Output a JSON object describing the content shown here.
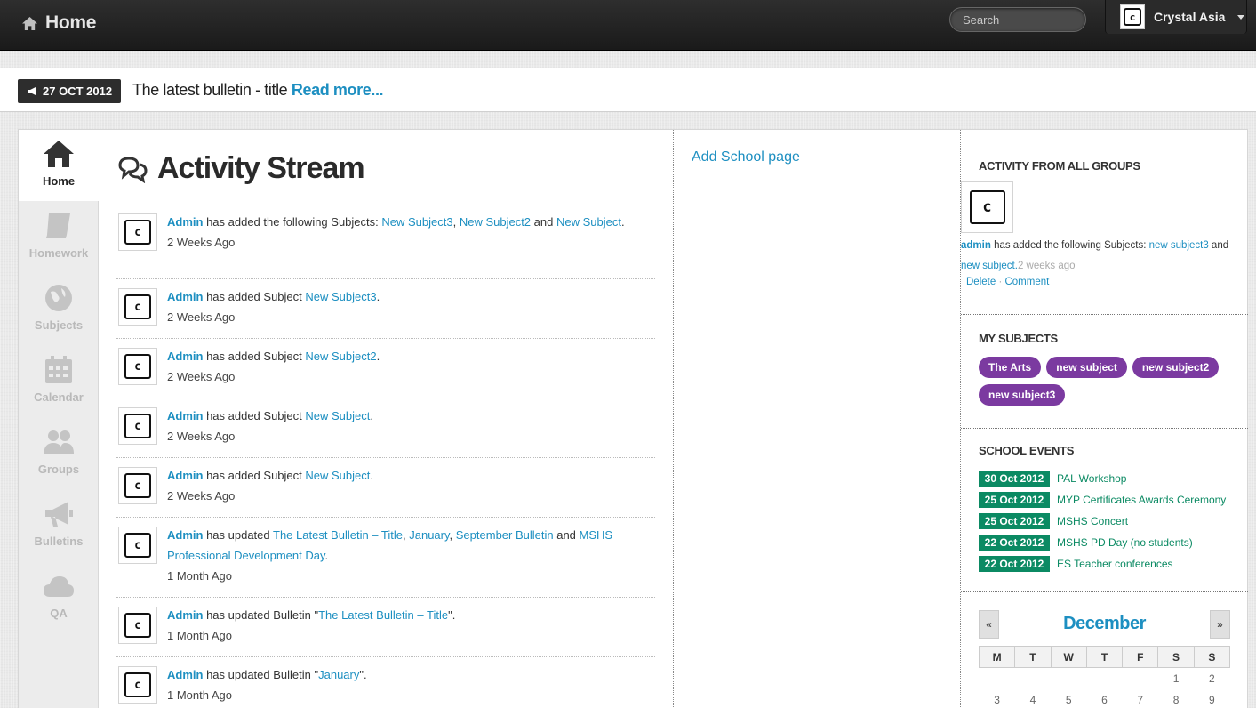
{
  "topbar": {
    "home_label": "Home",
    "search_placeholder": "Search",
    "user_name": "Crystal Asia"
  },
  "bulletin": {
    "date": "27 OCT 2012",
    "title": "The latest bulletin - title",
    "read_more": "Read more..."
  },
  "sidenav": {
    "items": [
      {
        "label": "Home",
        "icon": "home-icon"
      },
      {
        "label": "Homework",
        "icon": "book-icon"
      },
      {
        "label": "Subjects",
        "icon": "globe-icon"
      },
      {
        "label": "Calendar",
        "icon": "calendar-icon"
      },
      {
        "label": "Groups",
        "icon": "group-icon"
      },
      {
        "label": "Bulletins",
        "icon": "megaphone-icon"
      },
      {
        "label": "QA",
        "icon": "cloud-icon"
      }
    ]
  },
  "stream": {
    "title": "Activity Stream",
    "items": [
      {
        "actor": "Admin",
        "action": " has added the following Subjects: ",
        "links": [
          "New Subject3",
          "New Subject2",
          "New Subject"
        ],
        "time": "2 Weeks Ago"
      },
      {
        "actor": "Admin",
        "action": " has added Subject ",
        "links": [
          "New Subject3"
        ],
        "time": "2 Weeks Ago"
      },
      {
        "actor": "Admin",
        "action": " has added Subject ",
        "links": [
          "New Subject2"
        ],
        "time": "2 Weeks Ago"
      },
      {
        "actor": "Admin",
        "action": " has added Subject ",
        "links": [
          "New Subject"
        ],
        "time": "2 Weeks Ago"
      },
      {
        "actor": "Admin",
        "action": " has added Subject ",
        "links": [
          "New Subject"
        ],
        "time": "2 Weeks Ago"
      },
      {
        "actor": "Admin",
        "action": " has updated ",
        "links": [
          "The Latest Bulletin – Title",
          "January",
          "September Bulletin",
          "MSHS Professional Development Day"
        ],
        "time": "1 Month Ago"
      },
      {
        "actor": "Admin",
        "action": " has updated Bulletin \"",
        "links": [
          "The Latest Bulletin – Title"
        ],
        "time": "1 Month Ago"
      },
      {
        "actor": "Admin",
        "action": " has updated Bulletin \"",
        "links": [
          "January"
        ],
        "time": "1 Month Ago"
      }
    ]
  },
  "middle": {
    "add_school_page": "Add School page"
  },
  "activity_groups": {
    "title": "ACTIVITY FROM ALL GROUPS",
    "actor": "admin",
    "action": " has added the following Subjects: ",
    "link1": "new subject3",
    "and": " and ",
    "link2": "new subject.",
    "time": "2 weeks ago",
    "delete": "Delete",
    "comment": "Comment"
  },
  "my_subjects": {
    "title": "MY SUBJECTS",
    "items": [
      "The Arts",
      "new subject",
      "new subject2",
      "new subject3"
    ]
  },
  "school_events": {
    "title": "SCHOOL EVENTS",
    "items": [
      {
        "date": "30 Oct 2012",
        "name": "PAL Workshop"
      },
      {
        "date": "25 Oct 2012",
        "name": "MYP Certificates Awards Ceremony"
      },
      {
        "date": "25 Oct 2012",
        "name": "MSHS Concert"
      },
      {
        "date": "22 Oct 2012",
        "name": "MSHS PD Day (no students)"
      },
      {
        "date": "22 Oct 2012",
        "name": "ES Teacher conferences"
      }
    ]
  },
  "calendar": {
    "month": "December",
    "prev": "«",
    "next": "»",
    "weekdays": [
      "M",
      "T",
      "W",
      "T",
      "F",
      "S",
      "S"
    ],
    "row1": [
      "",
      "",
      "",
      "",
      "",
      "1",
      "2"
    ],
    "row2": [
      "3",
      "4",
      "5",
      "6",
      "7",
      "8",
      "9"
    ]
  },
  "colors": {
    "link": "#1d8fc1",
    "pill": "#7b3aa0",
    "event": "#0b8a63"
  }
}
